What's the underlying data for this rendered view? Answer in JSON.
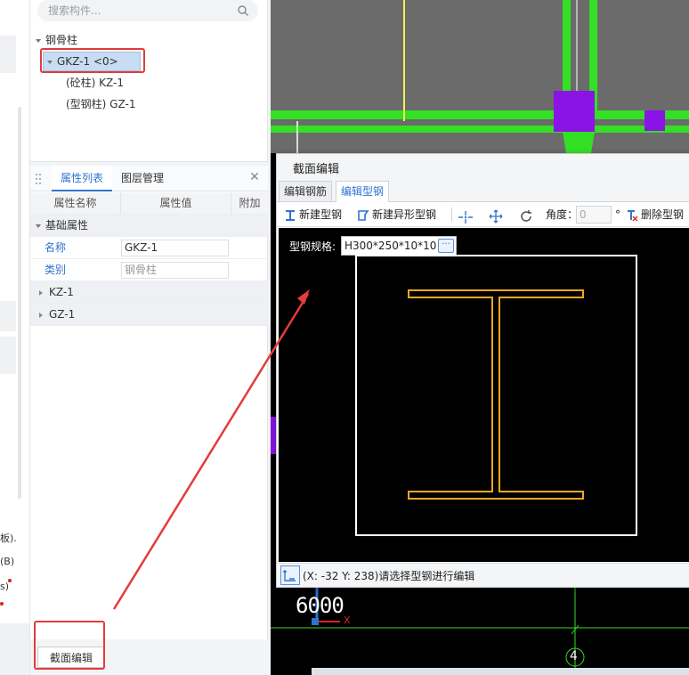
{
  "left_strip": {
    "frag1": "板).",
    "frag2": "(B)",
    "frag3": "s)"
  },
  "tree": {
    "search_placeholder": "搜索构件...",
    "root_label": "钢骨柱",
    "selected_node": "GKZ-1 <0>",
    "children": [
      "(砼柱) KZ-1",
      "(型钢柱) GZ-1"
    ]
  },
  "props": {
    "tabs": [
      "属性列表",
      "图层管理"
    ],
    "columns": [
      "属性名称",
      "属性值",
      "附加"
    ],
    "group_basic": "基础属性",
    "rows": [
      {
        "name": "名称",
        "value": "GKZ-1"
      },
      {
        "name": "类别",
        "value": "钢骨柱"
      }
    ],
    "groups_collapsed": [
      "KZ-1",
      "GZ-1"
    ]
  },
  "bottom": {
    "section_edit_button": "截面编辑"
  },
  "dialog": {
    "title": "截面编辑",
    "tabs": [
      "编辑钢筋",
      "编辑型钢"
    ],
    "toolbar": {
      "new_steel": "新建型钢",
      "new_special_steel": "新建异形型钢",
      "angle_label": "角度：",
      "angle_value": "0",
      "degree_sign": "°",
      "delete_steel": "删除型钢"
    },
    "spec_label": "型钢规格:",
    "spec_value": "H300*250*10*10",
    "spec_more": "···",
    "status": "(X: -32 Y: 238)请选择型钢进行编辑"
  },
  "canvas": {
    "dimension_text": "6000",
    "axis_label": "4",
    "x_axis_letter": "X"
  },
  "colors": {
    "accent": "#2f74d0",
    "highlight_red": "#e43b3b",
    "steel_orange": "#f5a623",
    "green_beam": "#33e024",
    "purple_column": "#8a14e6",
    "canvas_gray": "#6b6b6b"
  }
}
